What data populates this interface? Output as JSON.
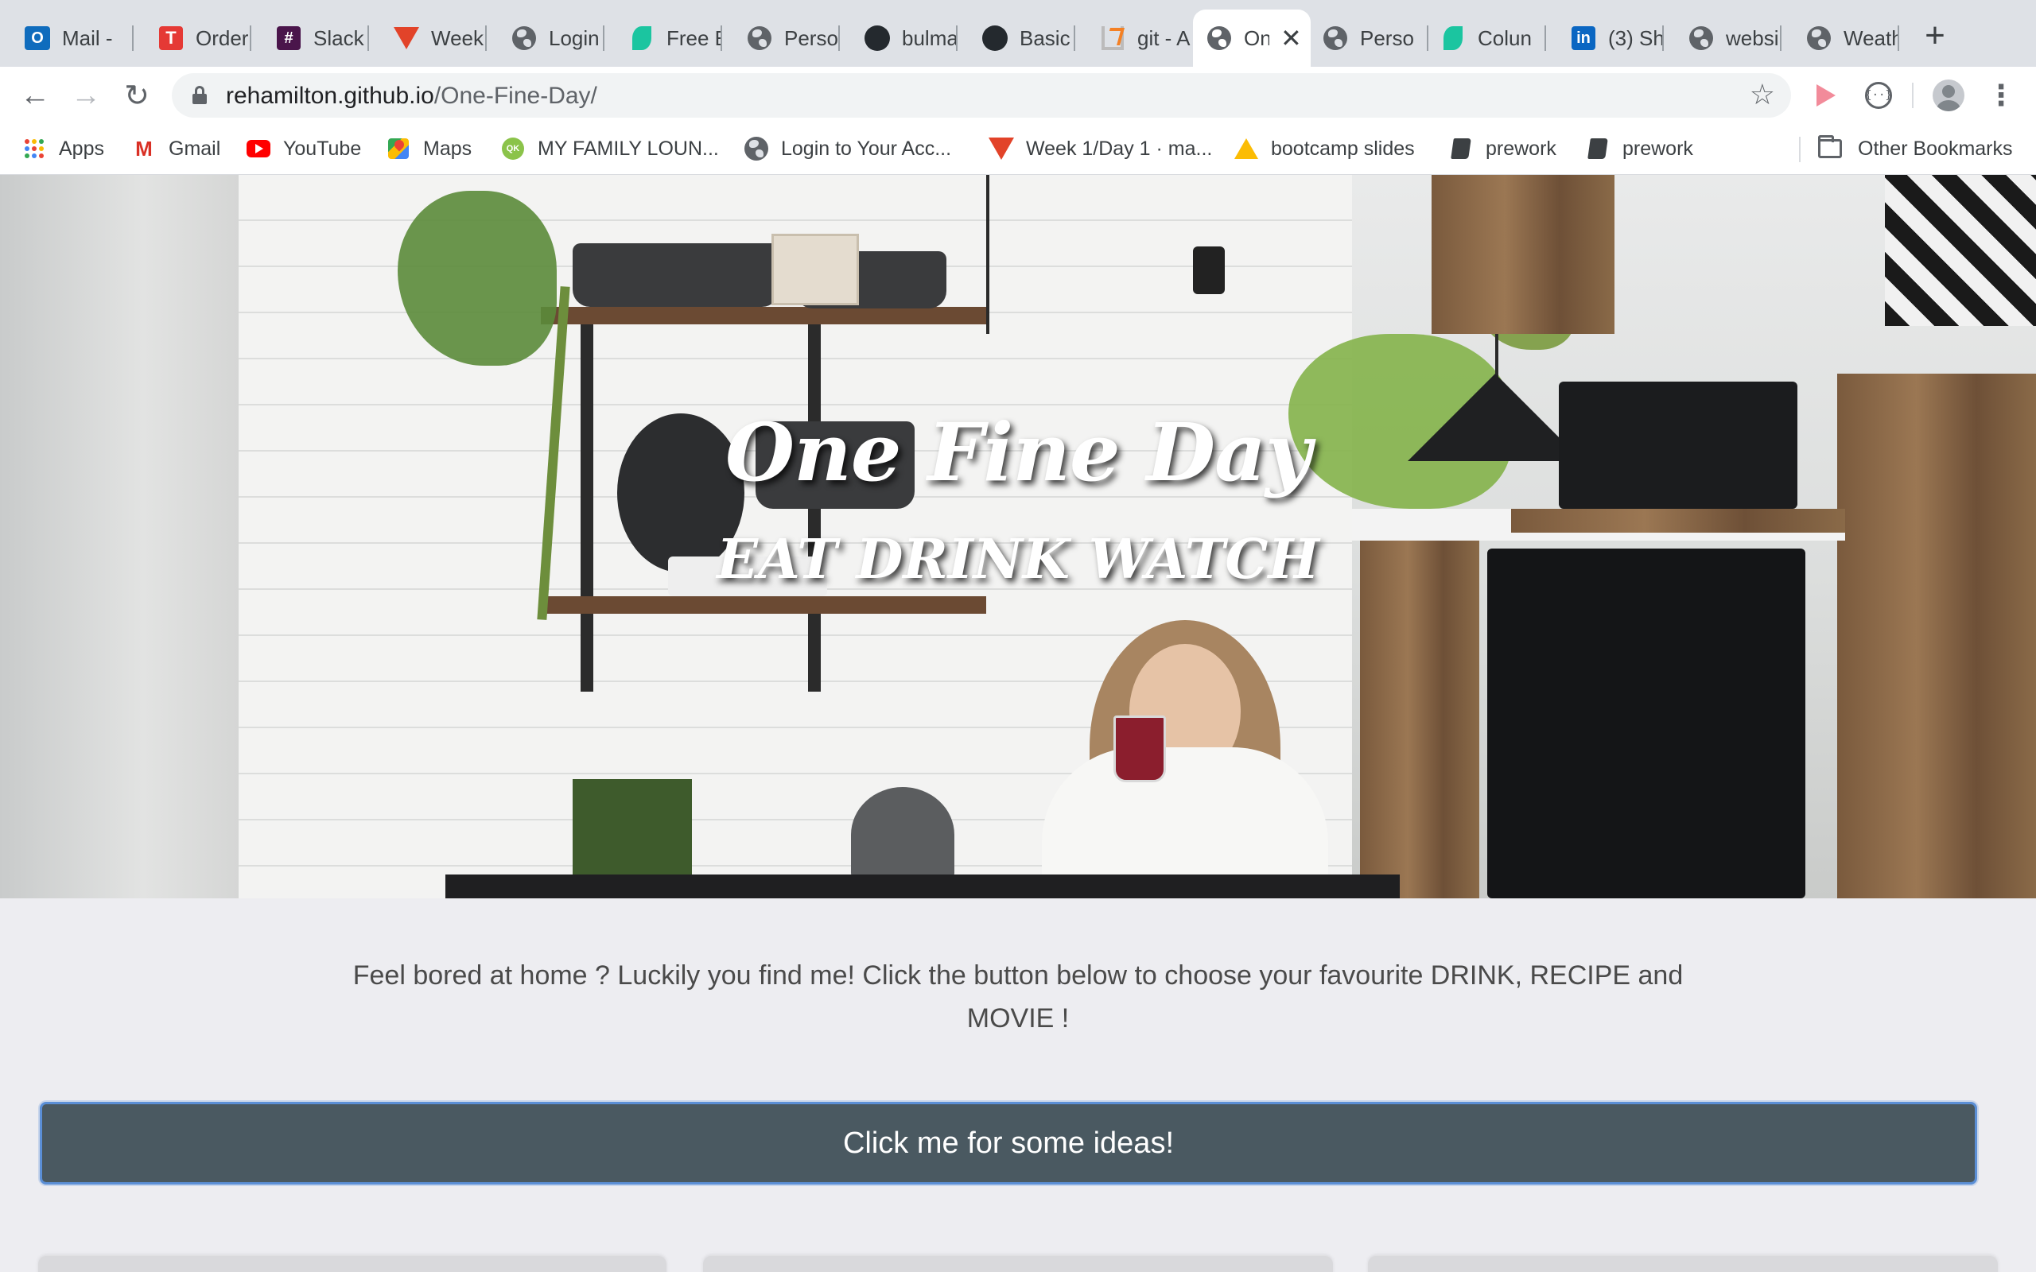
{
  "tabs": [
    {
      "title": "Mail -",
      "icon": "outlook-icon"
    },
    {
      "title": "Order",
      "icon": "trello-icon"
    },
    {
      "title": "Slack",
      "icon": "slack-icon"
    },
    {
      "title": "Week",
      "icon": "gitlab-icon"
    },
    {
      "title": "Login",
      "icon": "globe-icon"
    },
    {
      "title": "Free E",
      "icon": "leaf-icon"
    },
    {
      "title": "Perso",
      "icon": "globe-icon"
    },
    {
      "title": "bulma",
      "icon": "github-icon"
    },
    {
      "title": "Basic",
      "icon": "github-icon"
    },
    {
      "title": "git - A",
      "icon": "stackoverflow-icon"
    },
    {
      "title": "On",
      "icon": "globe-icon",
      "active": true
    },
    {
      "title": "Perso",
      "icon": "globe-icon"
    },
    {
      "title": "Colun",
      "icon": "leaf-icon"
    },
    {
      "title": "(3) Sh",
      "icon": "linkedin-icon"
    },
    {
      "title": "websi",
      "icon": "globe-icon"
    },
    {
      "title": "Weath",
      "icon": "globe-icon"
    }
  ],
  "address": {
    "host": "rehamilton.github.io",
    "path": "/One-Fine-Day/"
  },
  "bookmarks": [
    {
      "label": "Apps",
      "icon": "apps-grid-icon"
    },
    {
      "label": "Gmail",
      "icon": "gmail-icon"
    },
    {
      "label": "YouTube",
      "icon": "youtube-icon"
    },
    {
      "label": "Maps",
      "icon": "maps-icon"
    },
    {
      "label": "MY FAMILY LOUN...",
      "icon": "qk-icon"
    },
    {
      "label": "Login to Your Acc...",
      "icon": "globe-icon"
    },
    {
      "label": "Week 1/Day 1 · ma...",
      "icon": "gitlab-icon"
    },
    {
      "label": "bootcamp slides",
      "icon": "drive-icon"
    },
    {
      "label": "prework",
      "icon": "book-icon"
    },
    {
      "label": "prework",
      "icon": "book-icon"
    }
  ],
  "other_bookmarks": "Other Bookmarks",
  "hero": {
    "title": "One Fine Day",
    "subtitle": "EAT DRINK WATCH"
  },
  "intro": "Feel bored at home ? Luckily you find me! Click the button below to choose your favourite DRINK, RECIPE and MOVIE !",
  "cta_label": "Click me for some ideas!",
  "colors": {
    "cta_bg": "#4a5961",
    "cta_border": "#5b8fd6",
    "page_bg": "#ededf1"
  }
}
